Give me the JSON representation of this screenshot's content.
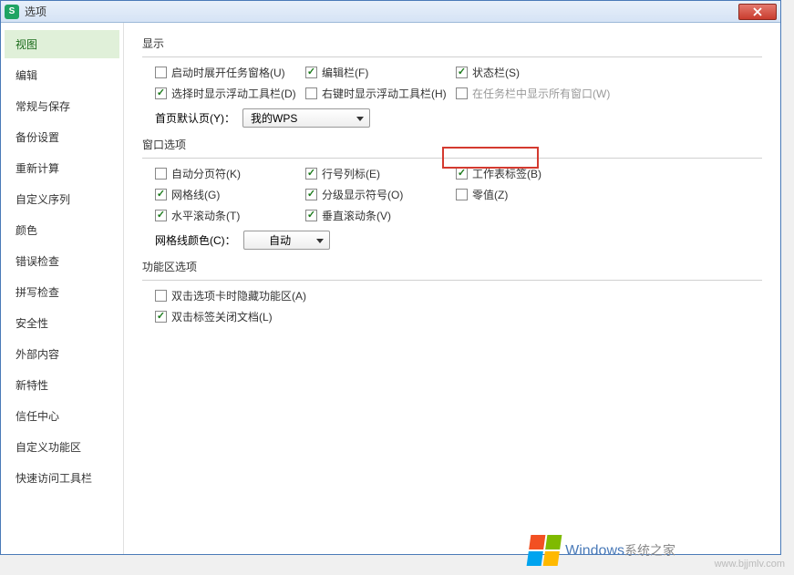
{
  "window": {
    "title": "选项"
  },
  "sidebar": {
    "items": [
      "视图",
      "编辑",
      "常规与保存",
      "备份设置",
      "重新计算",
      "自定义序列",
      "颜色",
      "错误检查",
      "拼写检查",
      "安全性",
      "外部内容",
      "新特性",
      "信任中心",
      "自定义功能区",
      "快速访问工具栏"
    ],
    "active_index": 0
  },
  "display": {
    "title": "显示",
    "startup_pane": "启动时展开任务窗格(U)",
    "formula_bar": "编辑栏(F)",
    "status_bar": "状态栏(S)",
    "float_select": "选择时显示浮动工具栏(D)",
    "float_right": "右键时显示浮动工具栏(H)",
    "show_all_windows": "在任务栏中显示所有窗口(W)"
  },
  "default_tab": {
    "label": "首页默认页(Y)：",
    "value": "我的WPS"
  },
  "window_opts": {
    "title": "窗口选项",
    "auto_page_break": "自动分页符(K)",
    "row_col_headers": "行号列标(E)",
    "sheet_tabs": "工作表标签(B)",
    "gridlines": "网格线(G)",
    "outline_symbols": "分级显示符号(O)",
    "zero_values": "零值(Z)",
    "hscroll": "水平滚动条(T)",
    "vscroll": "垂直滚动条(V)",
    "gridline_color_label": "网格线颜色(C)：",
    "gridline_color_value": "自动"
  },
  "ribbon": {
    "title": "功能区选项",
    "dblclick_hide": "双击选项卡时隐藏功能区(A)",
    "dblclick_close": "双击标签关闭文档(L)"
  },
  "watermark": {
    "main": "Windows",
    "sub": "系统之家",
    "url": "www.bjjmlv.com"
  }
}
